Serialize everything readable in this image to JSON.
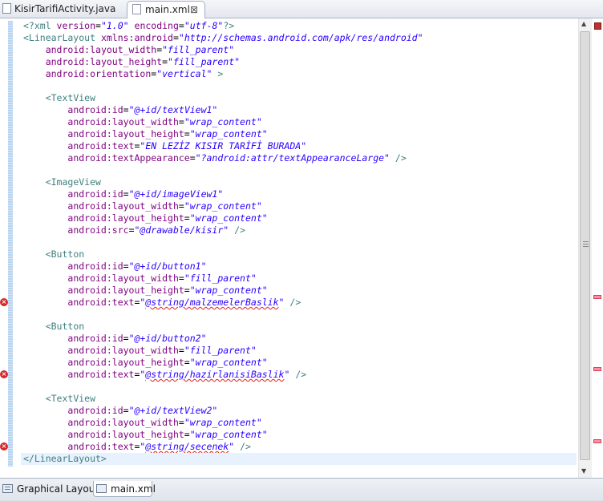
{
  "tabs": [
    {
      "label": "KisirTarifiActivity.java",
      "active": false,
      "icon": "java-file-icon"
    },
    {
      "label": "main.xml",
      "active": true,
      "icon": "xml-file-icon",
      "close": "⊠"
    }
  ],
  "editor": {
    "lines": [
      [
        [
          "proc",
          "<?xml "
        ],
        [
          "attr",
          "version"
        ],
        [
          "plain",
          "="
        ],
        [
          "val",
          "\"1.0\""
        ],
        [
          "plain",
          " "
        ],
        [
          "attr",
          "encoding"
        ],
        [
          "plain",
          "="
        ],
        [
          "val",
          "\"utf-8\""
        ],
        [
          "proc",
          "?>"
        ]
      ],
      [
        [
          "tag",
          "<LinearLayout "
        ],
        [
          "attr",
          "xmlns:android"
        ],
        [
          "plain",
          "="
        ],
        [
          "val",
          "\"http://schemas.android.com/apk/res/android\""
        ]
      ],
      [
        [
          "plain",
          "    "
        ],
        [
          "attr",
          "android:layout_width"
        ],
        [
          "plain",
          "="
        ],
        [
          "val",
          "\"fill_parent\""
        ]
      ],
      [
        [
          "plain",
          "    "
        ],
        [
          "attr",
          "android:layout_height"
        ],
        [
          "plain",
          "="
        ],
        [
          "val",
          "\"fill_parent\""
        ]
      ],
      [
        [
          "plain",
          "    "
        ],
        [
          "attr",
          "android:orientation"
        ],
        [
          "plain",
          "="
        ],
        [
          "val",
          "\"vertical\""
        ],
        [
          "plain",
          " "
        ],
        [
          "tag",
          ">"
        ]
      ],
      [],
      [
        [
          "plain",
          "    "
        ],
        [
          "tag",
          "<TextView"
        ]
      ],
      [
        [
          "plain",
          "        "
        ],
        [
          "attr",
          "android:id"
        ],
        [
          "plain",
          "="
        ],
        [
          "val",
          "\"@+id/textView1\""
        ]
      ],
      [
        [
          "plain",
          "        "
        ],
        [
          "attr",
          "android:layout_width"
        ],
        [
          "plain",
          "="
        ],
        [
          "val",
          "\"wrap_content\""
        ]
      ],
      [
        [
          "plain",
          "        "
        ],
        [
          "attr",
          "android:layout_height"
        ],
        [
          "plain",
          "="
        ],
        [
          "val",
          "\"wrap_content\""
        ]
      ],
      [
        [
          "plain",
          "        "
        ],
        [
          "attr",
          "android:text"
        ],
        [
          "plain",
          "="
        ],
        [
          "val",
          "\"EN LEZİZ KISIR TARİFİ BURADA\""
        ]
      ],
      [
        [
          "plain",
          "        "
        ],
        [
          "attr",
          "android:textAppearance"
        ],
        [
          "plain",
          "="
        ],
        [
          "val",
          "\"?android:attr/textAppearanceLarge\""
        ],
        [
          "plain",
          " "
        ],
        [
          "tag",
          "/>"
        ]
      ],
      [],
      [
        [
          "plain",
          "    "
        ],
        [
          "tag",
          "<ImageView"
        ]
      ],
      [
        [
          "plain",
          "        "
        ],
        [
          "attr",
          "android:id"
        ],
        [
          "plain",
          "="
        ],
        [
          "val",
          "\"@+id/imageView1\""
        ]
      ],
      [
        [
          "plain",
          "        "
        ],
        [
          "attr",
          "android:layout_width"
        ],
        [
          "plain",
          "="
        ],
        [
          "val",
          "\"wrap_content\""
        ]
      ],
      [
        [
          "plain",
          "        "
        ],
        [
          "attr",
          "android:layout_height"
        ],
        [
          "plain",
          "="
        ],
        [
          "val",
          "\"wrap_content\""
        ]
      ],
      [
        [
          "plain",
          "        "
        ],
        [
          "attr",
          "android:src"
        ],
        [
          "plain",
          "="
        ],
        [
          "val",
          "\"@drawable/kisir\""
        ],
        [
          "plain",
          " "
        ],
        [
          "tag",
          "/>"
        ]
      ],
      [],
      [
        [
          "plain",
          "    "
        ],
        [
          "tag",
          "<Button"
        ]
      ],
      [
        [
          "plain",
          "        "
        ],
        [
          "attr",
          "android:id"
        ],
        [
          "plain",
          "="
        ],
        [
          "val",
          "\"@+id/button1\""
        ]
      ],
      [
        [
          "plain",
          "        "
        ],
        [
          "attr",
          "android:layout_width"
        ],
        [
          "plain",
          "="
        ],
        [
          "val",
          "\"fill_parent\""
        ]
      ],
      [
        [
          "plain",
          "        "
        ],
        [
          "attr",
          "android:layout_height"
        ],
        [
          "plain",
          "="
        ],
        [
          "val",
          "\"wrap_content\""
        ]
      ],
      [
        [
          "plain",
          "        "
        ],
        [
          "attr",
          "android:text"
        ],
        [
          "plain",
          "="
        ],
        [
          "val",
          "\""
        ],
        [
          "err",
          "@string/malzemelerBaslik"
        ],
        [
          "val",
          "\""
        ],
        [
          "plain",
          " "
        ],
        [
          "tag",
          "/>"
        ]
      ],
      [],
      [
        [
          "plain",
          "    "
        ],
        [
          "tag",
          "<Button"
        ]
      ],
      [
        [
          "plain",
          "        "
        ],
        [
          "attr",
          "android:id"
        ],
        [
          "plain",
          "="
        ],
        [
          "val",
          "\"@+id/button2\""
        ]
      ],
      [
        [
          "plain",
          "        "
        ],
        [
          "attr",
          "android:layout_width"
        ],
        [
          "plain",
          "="
        ],
        [
          "val",
          "\"fill_parent\""
        ]
      ],
      [
        [
          "plain",
          "        "
        ],
        [
          "attr",
          "android:layout_height"
        ],
        [
          "plain",
          "="
        ],
        [
          "val",
          "\"wrap_content\""
        ]
      ],
      [
        [
          "plain",
          "        "
        ],
        [
          "attr",
          "android:text"
        ],
        [
          "plain",
          "="
        ],
        [
          "val",
          "\""
        ],
        [
          "err",
          "@string/hazirlanisiBaslik"
        ],
        [
          "val",
          "\""
        ],
        [
          "plain",
          " "
        ],
        [
          "tag",
          "/>"
        ]
      ],
      [],
      [
        [
          "plain",
          "    "
        ],
        [
          "tag",
          "<TextView"
        ]
      ],
      [
        [
          "plain",
          "        "
        ],
        [
          "attr",
          "android:id"
        ],
        [
          "plain",
          "="
        ],
        [
          "val",
          "\"@+id/textView2\""
        ]
      ],
      [
        [
          "plain",
          "        "
        ],
        [
          "attr",
          "android:layout_width"
        ],
        [
          "plain",
          "="
        ],
        [
          "val",
          "\"wrap_content\""
        ]
      ],
      [
        [
          "plain",
          "        "
        ],
        [
          "attr",
          "android:layout_height"
        ],
        [
          "plain",
          "="
        ],
        [
          "val",
          "\"wrap_content\""
        ]
      ],
      [
        [
          "plain",
          "        "
        ],
        [
          "attr",
          "android:text"
        ],
        [
          "plain",
          "="
        ],
        [
          "val",
          "\""
        ],
        [
          "err",
          "@string/secenek"
        ],
        [
          "val",
          "\""
        ],
        [
          "plain",
          " "
        ],
        [
          "tag",
          "/>"
        ]
      ],
      [
        [
          "tag",
          "</LinearLayout>"
        ]
      ]
    ],
    "current_line": 37,
    "error_lines": [
      24,
      30,
      36
    ],
    "error_icon": "error-marker-icon"
  },
  "bottom_tabs": [
    {
      "label": "Graphical Layout",
      "active": false,
      "icon": "graphical-layout-icon"
    },
    {
      "label": "main.xml",
      "active": true,
      "icon": "xml-source-icon"
    }
  ],
  "colors": {
    "tag": "#3f7f7f",
    "attribute": "#7f007f",
    "value": "#2a00ff",
    "error": "#d62828",
    "current_line": "#e8f2fe"
  }
}
